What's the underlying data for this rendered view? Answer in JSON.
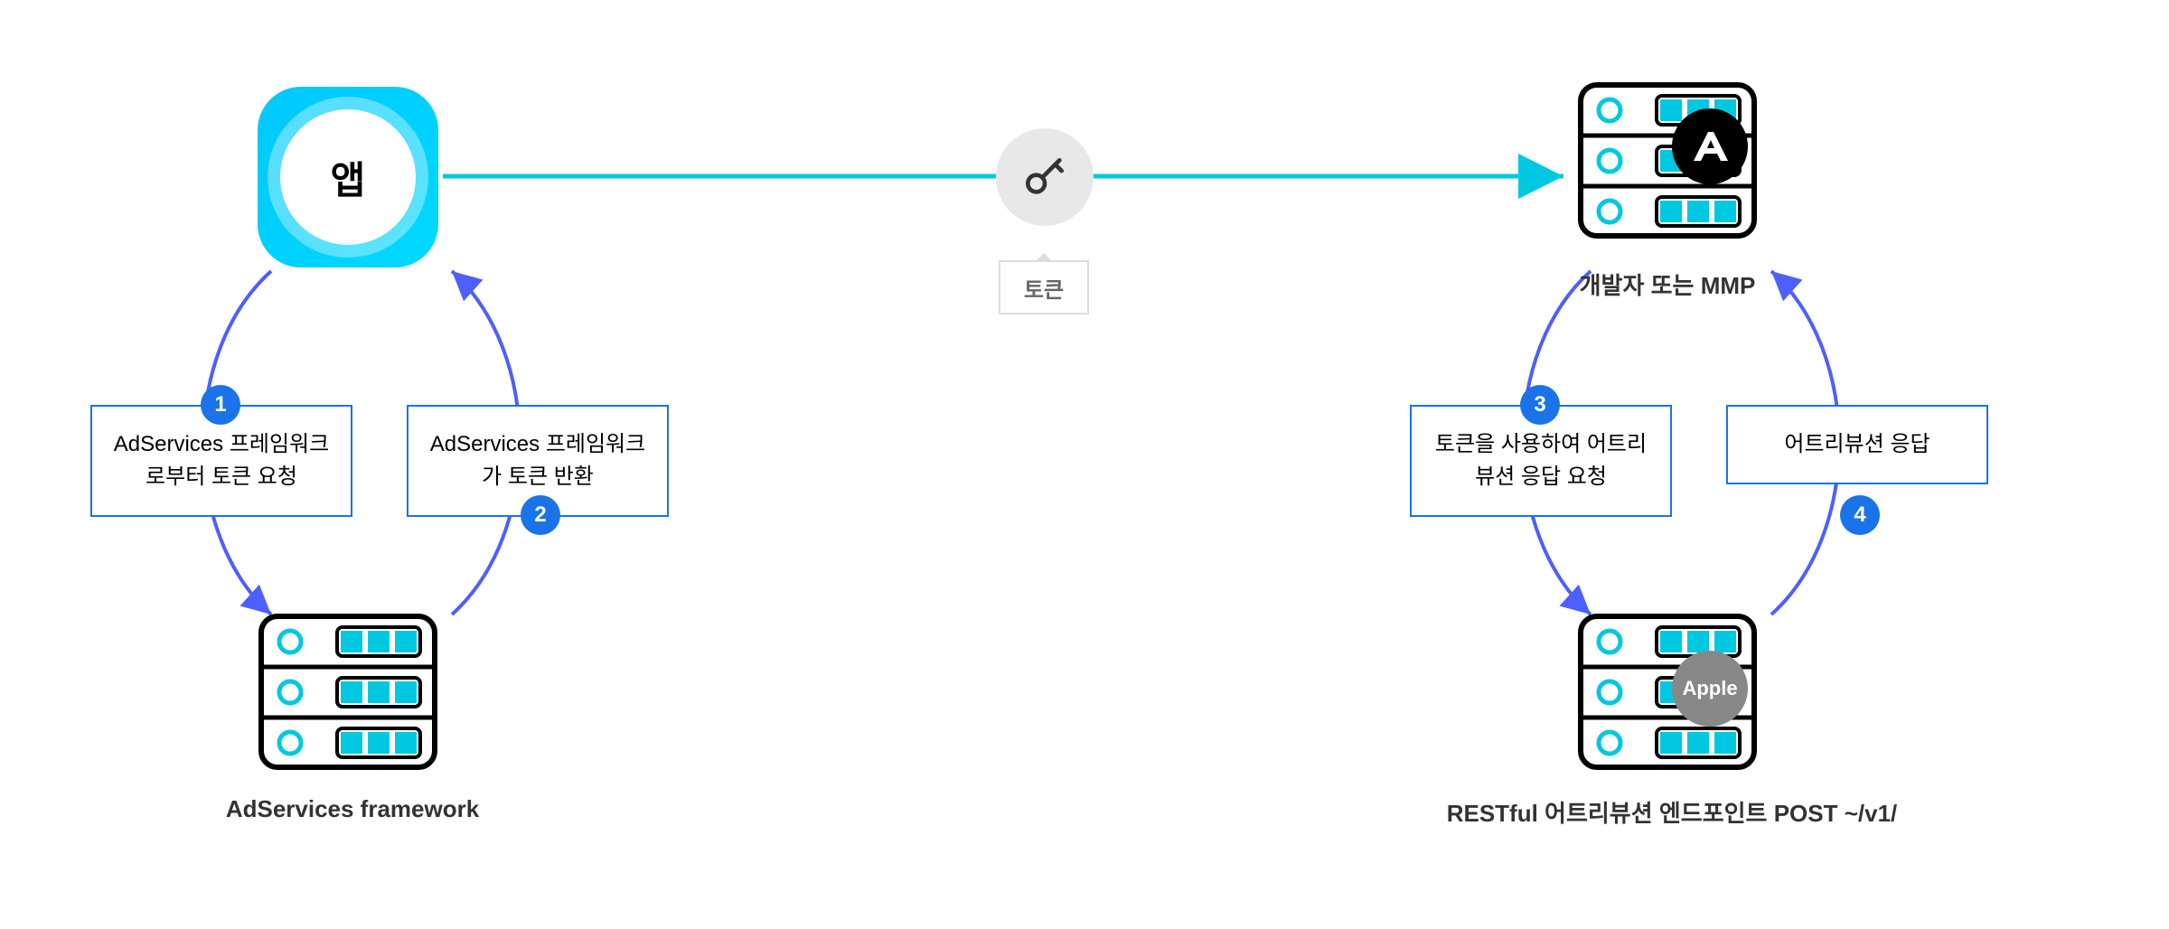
{
  "app": {
    "label": "앱"
  },
  "token": {
    "label": "토큰"
  },
  "steps": {
    "1": {
      "num": "1",
      "text": "AdServices 프레임워크로부터 토큰 요청"
    },
    "2": {
      "num": "2",
      "text": "AdServices 프레임워크가 토큰 반환"
    },
    "3": {
      "num": "3",
      "text": "토큰을 사용하여 어트리뷰션 응답 요청"
    },
    "4": {
      "num": "4",
      "text": "어트리뷰션 응답"
    }
  },
  "labels": {
    "adservices_framework": "AdServices framework",
    "developer_or_mmp": "개발자 또는 MMP",
    "restful_endpoint": "RESTful 어트리뷰션 엔드포인트 POST ~/v1/"
  },
  "badges": {
    "apple": "Apple"
  },
  "colors": {
    "blue": "#1a73e8",
    "cyan": "#00d9ff",
    "arrow": "#4d5fff"
  }
}
